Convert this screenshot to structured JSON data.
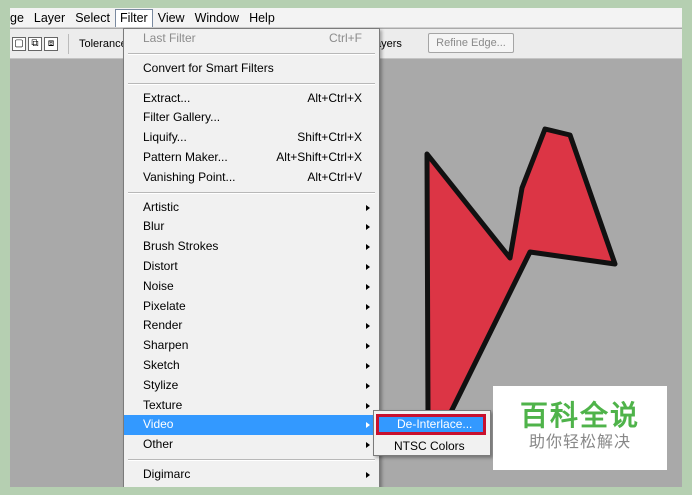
{
  "menubar": {
    "items": [
      "ge",
      "Layer",
      "Select",
      "Filter",
      "View",
      "Window",
      "Help"
    ],
    "active": "Filter"
  },
  "options": {
    "tolerance_label": "Tolerance:",
    "layers_label": "ayers",
    "refine_edge_label": "Refine Edge..."
  },
  "filter_menu": {
    "last_filter": {
      "label": "Last Filter",
      "shortcut": "Ctrl+F"
    },
    "convert_smart": "Convert for Smart Filters",
    "group2": [
      {
        "label": "Extract...",
        "shortcut": "Alt+Ctrl+X"
      },
      {
        "label": "Filter Gallery...",
        "shortcut": ""
      },
      {
        "label": "Liquify...",
        "shortcut": "Shift+Ctrl+X"
      },
      {
        "label": "Pattern Maker...",
        "shortcut": "Alt+Shift+Ctrl+X"
      },
      {
        "label": "Vanishing Point...",
        "shortcut": "Alt+Ctrl+V"
      }
    ],
    "submenus": [
      "Artistic",
      "Blur",
      "Brush Strokes",
      "Distort",
      "Noise",
      "Pixelate",
      "Render",
      "Sharpen",
      "Sketch",
      "Stylize",
      "Texture",
      "Video",
      "Other"
    ],
    "highlighted": "Video",
    "digimarc": "Digimarc"
  },
  "video_submenu": {
    "items": [
      "De-Interlace...",
      "NTSC Colors"
    ],
    "highlighted": "De-Interlace..."
  },
  "watermark": {
    "title": "百科全说",
    "subtitle": "助你轻松解决"
  },
  "colors": {
    "highlight": "#3399ff",
    "arrow_red": "#dc3545",
    "watermark_green": "#4fb34a"
  }
}
